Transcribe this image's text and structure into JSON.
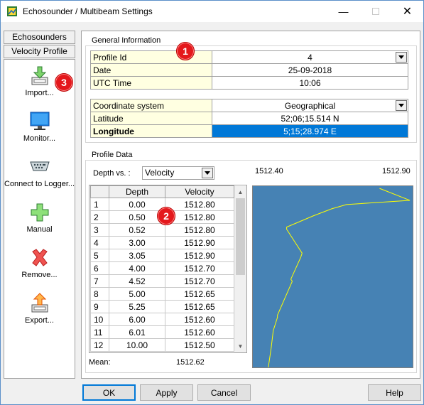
{
  "window": {
    "title": "Echosounder / Multibeam Settings",
    "minimize_icon": "minimize-icon",
    "maximize_icon": "maximize-icon",
    "close_icon": "close-icon"
  },
  "sidebar": {
    "tabs": [
      {
        "label": "Echosounders"
      },
      {
        "label": "Velocity Profile"
      }
    ],
    "actions": [
      {
        "label": "Import...",
        "icon": "import-icon"
      },
      {
        "label": "Monitor...",
        "icon": "monitor-icon"
      },
      {
        "label": "Connect to Logger...",
        "icon": "serial-port-icon"
      },
      {
        "label": "Manual",
        "icon": "add-icon"
      },
      {
        "label": "Remove...",
        "icon": "remove-icon"
      },
      {
        "label": "Export...",
        "icon": "export-icon"
      }
    ]
  },
  "general_info": {
    "label": "General Information",
    "rows": [
      {
        "key": "Profile Id",
        "value": "4"
      },
      {
        "key": "Date",
        "value": "25-09-2018"
      },
      {
        "key": "UTC Time",
        "value": "10:06"
      }
    ],
    "coord_rows": [
      {
        "key": "Coordinate system",
        "value": "Geographical"
      },
      {
        "key": "Latitude",
        "value": "52;06;15.514 N"
      },
      {
        "key": "Longitude",
        "value": "5;15;28.974 E"
      }
    ]
  },
  "profile_data": {
    "label": "Profile Data",
    "depth_vs_label": "Depth vs. :",
    "depth_vs_value": "Velocity",
    "columns": [
      "Depth",
      "Velocity"
    ],
    "rows": [
      [
        "1",
        "0.00",
        "1512.80"
      ],
      [
        "2",
        "0.50",
        "1512.80"
      ],
      [
        "3",
        "0.52",
        "1512.80"
      ],
      [
        "4",
        "3.00",
        "1512.90"
      ],
      [
        "5",
        "3.05",
        "1512.90"
      ],
      [
        "6",
        "4.00",
        "1512.70"
      ],
      [
        "7",
        "4.52",
        "1512.70"
      ],
      [
        "8",
        "5.00",
        "1512.65"
      ],
      [
        "9",
        "5.25",
        "1512.65"
      ],
      [
        "10",
        "6.00",
        "1512.60"
      ],
      [
        "11",
        "6.01",
        "1512.60"
      ],
      [
        "12",
        "10.00",
        "1512.50"
      ]
    ],
    "mean_label": "Mean:",
    "mean_value": "1512.62",
    "plot_min": "1512.40",
    "plot_max": "1512.90"
  },
  "badges": [
    "1",
    "2",
    "3"
  ],
  "buttons": {
    "ok": "OK",
    "apply": "Apply",
    "cancel": "Cancel",
    "help": "Help"
  },
  "colors": {
    "plot_bg": "#4682b4",
    "plot_line": "#ffff00",
    "selection": "#0078d7",
    "key_cell_bg": "#ffffe1",
    "badge": "#e4181c"
  }
}
